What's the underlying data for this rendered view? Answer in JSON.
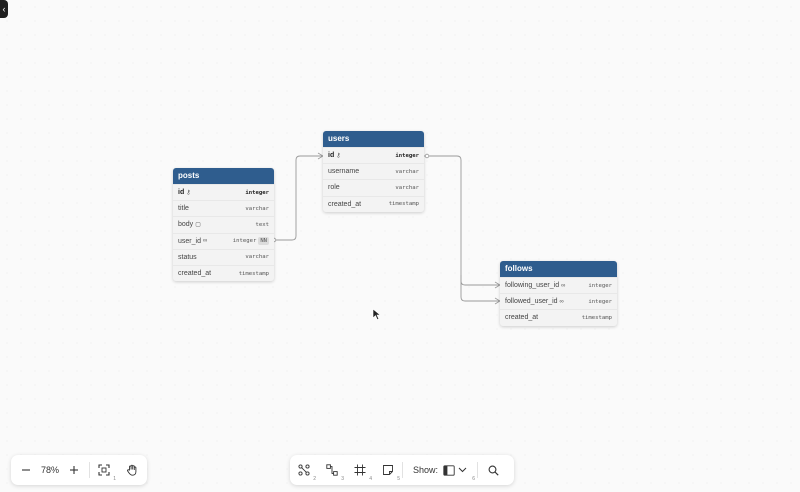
{
  "tables": [
    {
      "name": "posts",
      "fields": [
        {
          "name": "id",
          "type": "integer",
          "pk": true,
          "icon": "key-icon"
        },
        {
          "name": "title",
          "type": "varchar"
        },
        {
          "name": "body",
          "type": "text",
          "icon": "note-icon"
        },
        {
          "name": "user_id",
          "type": "integer",
          "icon": "link-icon",
          "badge": "NN"
        },
        {
          "name": "status",
          "type": "varchar"
        },
        {
          "name": "created_at",
          "type": "timestamp"
        }
      ]
    },
    {
      "name": "users",
      "fields": [
        {
          "name": "id",
          "type": "integer",
          "pk": true,
          "icon": "key-icon"
        },
        {
          "name": "username",
          "type": "varchar"
        },
        {
          "name": "role",
          "type": "varchar"
        },
        {
          "name": "created_at",
          "type": "timestamp"
        }
      ]
    },
    {
      "name": "follows",
      "fields": [
        {
          "name": "following_user_id",
          "type": "integer",
          "icon": "link-icon"
        },
        {
          "name": "followed_user_id",
          "type": "integer",
          "icon": "link-icon"
        },
        {
          "name": "created_at",
          "type": "timestamp"
        }
      ]
    }
  ],
  "relationships": [
    {
      "from": "posts.user_id",
      "to": "users.id"
    },
    {
      "from": "follows.following_user_id",
      "to": "users.id"
    },
    {
      "from": "follows.followed_user_id",
      "to": "users.id"
    }
  ],
  "zoom_controls": {
    "zoom_value": "78%",
    "fit_shortcut": "1"
  },
  "tools": {
    "shortcuts": [
      "2",
      "3",
      "4",
      "5",
      "6"
    ],
    "show_label": "Show:"
  },
  "colors": {
    "table_header": "#2f5d8e",
    "edge": "#9a9a9a"
  }
}
